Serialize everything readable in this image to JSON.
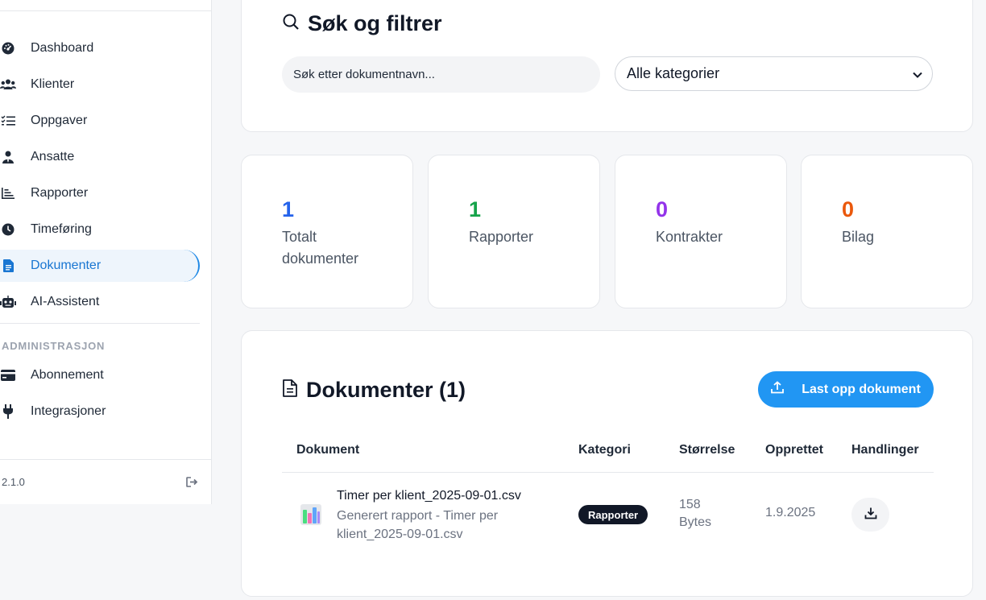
{
  "sidebar": {
    "items": [
      {
        "label": "Dashboard",
        "icon": "dashboard-gauge-icon"
      },
      {
        "label": "Klienter",
        "icon": "users-icon"
      },
      {
        "label": "Oppgaver",
        "icon": "task-list-icon"
      },
      {
        "label": "Ansatte",
        "icon": "employee-icon"
      },
      {
        "label": "Rapporter",
        "icon": "chart-icon"
      },
      {
        "label": "Timeføring",
        "icon": "clock-icon"
      },
      {
        "label": "Dokumenter",
        "icon": "document-icon",
        "active": true
      },
      {
        "label": "AI-Assistent",
        "icon": "robot-icon"
      }
    ],
    "admin_section_title": "ADMINISTRASJON",
    "admin_items": [
      {
        "label": "Abonnement",
        "icon": "credit-card-icon"
      },
      {
        "label": "Integrasjoner",
        "icon": "plug-icon"
      }
    ],
    "version": "2.1.0",
    "accent_color": "#1976d2"
  },
  "search": {
    "title": "Søk og filtrer",
    "placeholder": "Søk etter dokumentnavn...",
    "category_selected": "Alle kategorier"
  },
  "stats": [
    {
      "value": "1",
      "label": "Totalt dokumenter",
      "color": "#2563eb"
    },
    {
      "value": "1",
      "label": "Rapporter",
      "color": "#16a34a"
    },
    {
      "value": "0",
      "label": "Kontrakter",
      "color": "#9333ea"
    },
    {
      "value": "0",
      "label": "Bilag",
      "color": "#ea580c"
    }
  ],
  "documents": {
    "title": "Dokumenter (1)",
    "upload_label": "Last opp dokument",
    "columns": {
      "document": "Dokument",
      "category": "Kategori",
      "size": "Størrelse",
      "created": "Opprettet",
      "actions": "Handlinger"
    },
    "rows": [
      {
        "name": "Timer per klient_2025-09-01.csv",
        "description": "Generert rapport - Timer per klient_2025-09-01.csv",
        "category": "Rapporter",
        "size": "158 Bytes",
        "created": "1.9.2025",
        "icon": "chart-file-icon"
      }
    ]
  },
  "colors": {
    "primary_button": "#2196f3",
    "badge_bg": "#111827"
  }
}
